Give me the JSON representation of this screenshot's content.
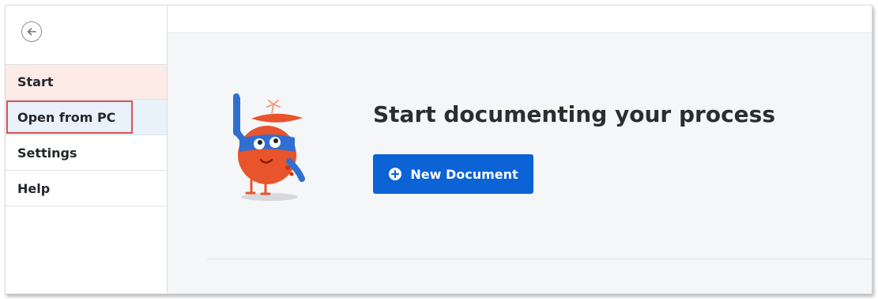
{
  "sidebar": {
    "back_icon": "arrow-left-circle-icon",
    "items": [
      {
        "label": "Start",
        "state": "active"
      },
      {
        "label": "Open from PC",
        "state": "hover"
      },
      {
        "label": "Settings",
        "state": "default"
      },
      {
        "label": "Help",
        "state": "default"
      }
    ]
  },
  "main": {
    "headline": "Start documenting your process",
    "new_document_button": {
      "label": "New Document",
      "icon": "plus-circle-icon"
    },
    "illustration": "mascot-icon"
  },
  "colors": {
    "accent": "#0b63d6",
    "active_item_bg": "#fcebe7",
    "hover_item_bg": "#e9f1fb",
    "highlight_border": "#d9534f",
    "content_bg": "#f4f6f8",
    "mascot_orange": "#e8542b",
    "mascot_blue": "#2f6fd1"
  }
}
